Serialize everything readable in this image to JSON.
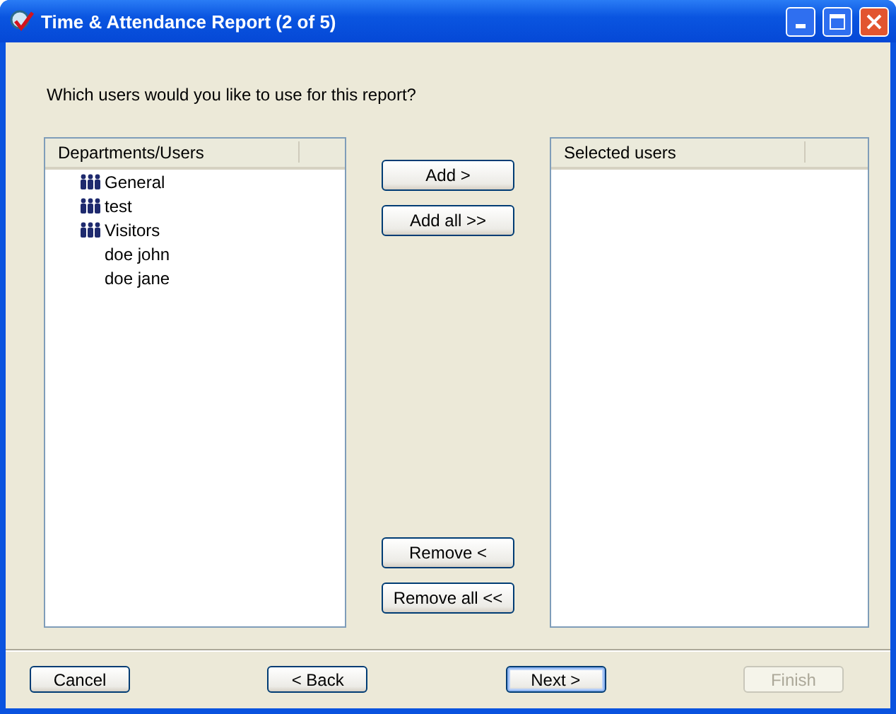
{
  "window": {
    "title": "Time & Attendance Report (2 of 5)"
  },
  "prompt": "Which users would you like to use for this report?",
  "source_list": {
    "header": "Departments/Users",
    "items": [
      {
        "label": "General",
        "kind": "group"
      },
      {
        "label": "test",
        "kind": "group"
      },
      {
        "label": "Visitors",
        "kind": "group"
      },
      {
        "label": "doe john",
        "kind": "user"
      },
      {
        "label": "doe jane",
        "kind": "user"
      }
    ]
  },
  "add_buttons": [
    "Add >",
    "Add all >>"
  ],
  "remove_buttons": [
    "Remove <",
    "Remove all <<"
  ],
  "target_list": {
    "header": "Selected users"
  },
  "footer_buttons": [
    {
      "label": "Cancel",
      "disabled": false,
      "default": false
    },
    {
      "label": "< Back",
      "disabled": false,
      "default": false
    },
    {
      "label": "Next >",
      "disabled": false,
      "default": true
    },
    {
      "label": "Finish",
      "disabled": true,
      "default": false
    }
  ]
}
